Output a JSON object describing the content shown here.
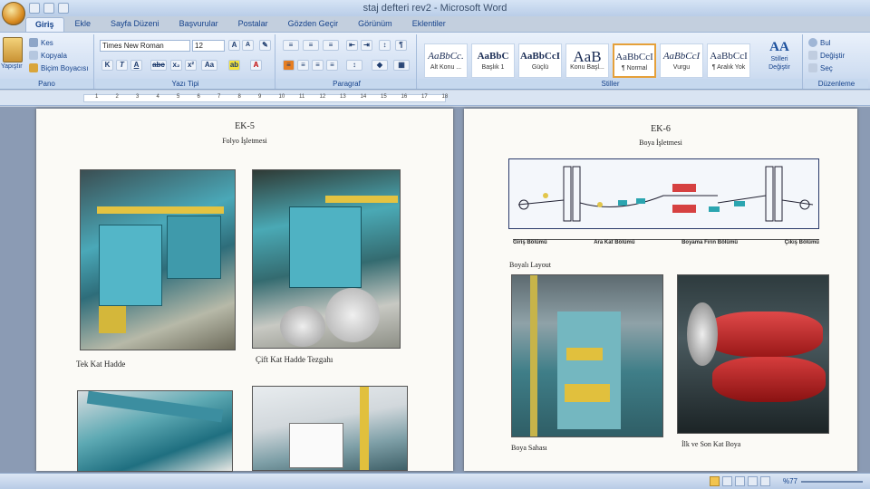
{
  "window": {
    "title": "staj defteri rev2 - Microsoft Word"
  },
  "tabs": [
    "Giriş",
    "Ekle",
    "Sayfa Düzeni",
    "Başvurular",
    "Postalar",
    "Gözden Geçir",
    "Görünüm",
    "Eklentiler"
  ],
  "ribbon": {
    "clipboard": {
      "paste": "Yapıştır",
      "cut": "Kes",
      "copy": "Kopyala",
      "format_painter": "Biçim Boyacısı",
      "label": "Pano"
    },
    "font": {
      "name": "Times New Roman",
      "size": "12",
      "label": "Yazı Tipi"
    },
    "paragraph": {
      "label": "Paragraf"
    },
    "styles": {
      "items": [
        {
          "sample": "AaBbCc.",
          "name": "Alt Konu ..."
        },
        {
          "sample": "AaBbC",
          "name": "Başlık 1"
        },
        {
          "sample": "AaBbCcI",
          "name": "Güçlü"
        },
        {
          "sample": "AaB",
          "name": "Konu Başl..."
        },
        {
          "sample": "AaBbCcI",
          "name": "¶ Normal"
        },
        {
          "sample": "AaBbCcI",
          "name": "Vurgu"
        },
        {
          "sample": "AaBbCcI",
          "name": "¶ Aralık Yok"
        }
      ],
      "change_styles": "Stilleri Değiştir",
      "label": "Stiller"
    },
    "editing": {
      "find": "Bul",
      "replace": "Değiştir",
      "select": "Seç",
      "label": "Düzenleme"
    }
  },
  "ruler": {
    "numbers": [
      "1",
      "2",
      "3",
      "4",
      "5",
      "6",
      "7",
      "8",
      "9",
      "10",
      "11",
      "12",
      "13",
      "14",
      "15",
      "16",
      "17",
      "18"
    ]
  },
  "page_left": {
    "heading": "EK-5",
    "subheading": "Folyo İşletmesi",
    "captions": [
      "Tek Kat Hadde",
      "Çift Kat Hadde Tezgahı"
    ]
  },
  "page_right": {
    "heading": "EK-6",
    "subheading": "Boya İşletmesi",
    "sections": [
      "Giriş Bölümü",
      "Ara Kat Bölümü",
      "Boyama Fırın Bölümü",
      "Çıkış Bölümü"
    ],
    "layout_label": "Boyalı Layout",
    "captions": [
      "Boya Sahası",
      "İlk ve Son Kat Boya"
    ]
  },
  "status": {
    "zoom": "%77"
  }
}
